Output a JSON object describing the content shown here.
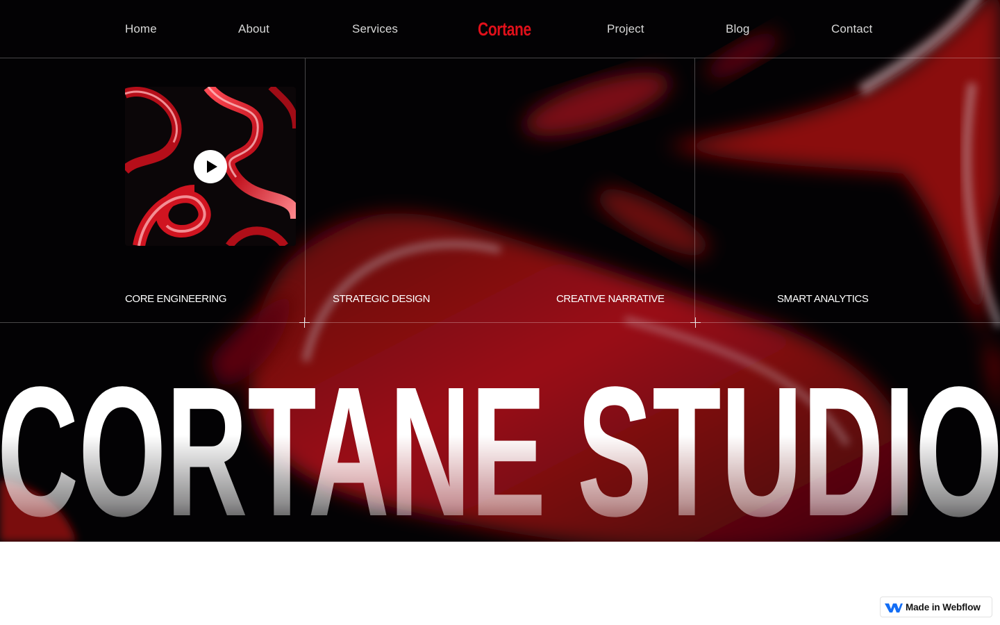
{
  "nav": {
    "items": [
      {
        "label": "Home"
      },
      {
        "label": "About"
      },
      {
        "label": "Services"
      },
      {
        "label": "Project"
      },
      {
        "label": "Blog"
      },
      {
        "label": "Contact"
      }
    ],
    "logo": "Cortane"
  },
  "services": [
    {
      "label": "CORE ENGINEERING"
    },
    {
      "label": "STRATEGIC DESIGN"
    },
    {
      "label": "CREATIVE NARRATIVE"
    },
    {
      "label": "SMART ANALYTICS"
    }
  ],
  "hero": {
    "title": "CORTANE STUDIO",
    "video": {
      "play_icon": "play-icon"
    }
  },
  "badge": {
    "label": "Made in Webflow",
    "icon": "webflow-icon"
  },
  "colors": {
    "background": "#030204",
    "accent": "#e0101a",
    "nav_text": "#d8d8d8",
    "blob_red": "#8a0a10"
  }
}
